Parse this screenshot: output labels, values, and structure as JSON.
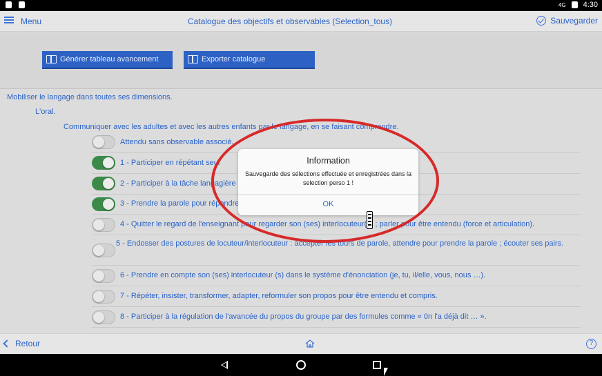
{
  "status_bar": {
    "time": "4:30",
    "icons": [
      "notification-icon",
      "android-icon",
      "network-icon",
      "battery-icon"
    ],
    "network_label": "4G"
  },
  "header": {
    "menu_label": "Menu",
    "title": "Catalogue des objectifs et observables (Selection_tous)",
    "save_label": "Sauvegarder"
  },
  "toolbar": {
    "button1_label": "Générer tableau avancement",
    "button2_label": "Exporter catalogue"
  },
  "tree": {
    "level1": "Mobiliser le langage dans toutes ses dimensions.",
    "level2": "L'oral.",
    "level3": "Communiquer avec les adultes et avec les autres enfants par le langage, en se faisant comprendre."
  },
  "items": [
    {
      "label": "Attendu sans observable associé.",
      "on": false
    },
    {
      "label": "1 - Participer en répétant seul",
      "on": true
    },
    {
      "label": "2 - Participer à la tâche langagière",
      "on": true
    },
    {
      "label": "3 - Prendre la parole pour répondre",
      "on": true
    },
    {
      "label": "4 - Quitter le regard de l'enseignant pour regarder son (ses) interlocuteur(s) ; parler pour être entendu (force et articulation).",
      "on": false
    },
    {
      "label": "5 - Endosser des postures de locuteur/interlocuteur : accepter les tours de parole, attendre pour prendre la parole ; écouter ses pairs.",
      "on": false
    },
    {
      "label": "6 - Prendre en compte son (ses) interlocuteur (s) dans le système d'énonciation (je, tu, il/elle, vous, nous …).",
      "on": false
    },
    {
      "label": "7 - Répéter, insister, transformer, adapter, reformuler son propos pour être entendu et compris.",
      "on": false
    },
    {
      "label": "8 - Participer à la régulation de l'avancée du propos du groupe par des formules comme « 0n l'a déjà dit … ».",
      "on": false
    }
  ],
  "dialog": {
    "title": "Information",
    "message": "Sauvegarde des sélections effectuée et enregistrées dans la selection perso 1 !",
    "ok_label": "OK"
  },
  "footer": {
    "back_label": "Retour",
    "help_label": "?"
  },
  "colors": {
    "accent": "#2a63c9",
    "toggle_on": "#3c8a4a",
    "annotation": "#d62a2a",
    "button_bg": "#2d62c4"
  }
}
